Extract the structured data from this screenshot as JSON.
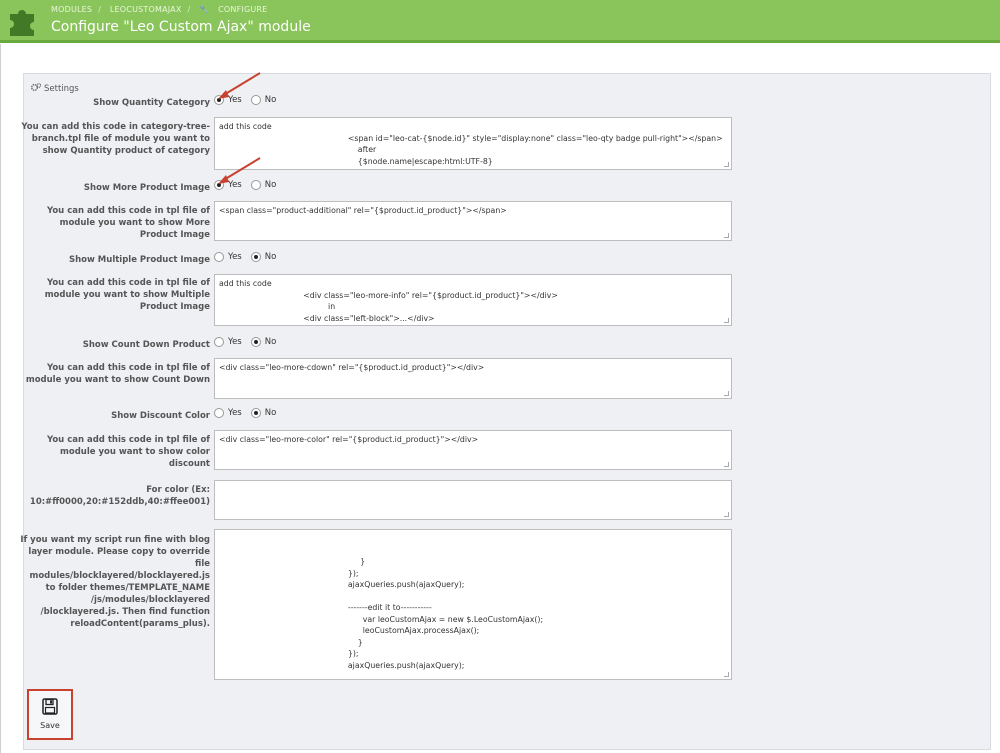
{
  "header": {
    "breadcrumbs": [
      "MODULES",
      "LEOCUSTOMAJAX",
      "CONFIGURE"
    ],
    "title": "Configure \"Leo Custom Ajax\" module"
  },
  "panel": {
    "heading": "Settings"
  },
  "fields": {
    "show_qty_category": {
      "label": "Show Quantity Category",
      "yes": "Yes",
      "no": "No",
      "value": "yes"
    },
    "qty_code": {
      "label": "You can add this code in category-tree-branch.tpl file of module you want to show Quantity product of category",
      "value": "add this code\n                                                    <span id=\"leo-cat-{$node.id}\" style=\"display:none\" class=\"leo-qty badge pull-right\"></span>\n                                                        after\n                                                        {$node.name|escape:html:UTF-8}"
    },
    "show_more_image": {
      "label": "Show More Product Image",
      "yes": "Yes",
      "no": "No",
      "value": "yes"
    },
    "more_image_code": {
      "label": "You can add this code in tpl file of module you want to show More Product Image",
      "value": "<span class=\"product-additional\" rel=\"{$product.id_product}\"></span>"
    },
    "show_multiple_image": {
      "label": "Show Multiple Product Image",
      "yes": "Yes",
      "no": "No",
      "value": "no"
    },
    "multiple_image_code": {
      "label": "You can add this code in tpl file of module you want to show Multiple Product Image",
      "value": "add this code\n                                  <div class=\"leo-more-info\" rel=\"{$product.id_product}\"></div>\n                                            in\n                                  <div class=\"left-block\">...</div>"
    },
    "show_countdown": {
      "label": "Show Count Down Product",
      "yes": "Yes",
      "no": "No",
      "value": "no"
    },
    "countdown_code": {
      "label": "You can add this code in tpl file of module you want to show Count Down",
      "value": "<div class=\"leo-more-cdown\" rel=\"{$product.id_product}\"></div>"
    },
    "show_discount_color": {
      "label": "Show Discount Color",
      "yes": "Yes",
      "no": "No",
      "value": "no"
    },
    "discount_color_code": {
      "label": "You can add this code in tpl file of module you want to show color discount",
      "value": "<div class=\"leo-more-color\" rel=\"{$product.id_product}\"></div>"
    },
    "for_color": {
      "label": "For color (Ex: 10:#ff0000,20:#152ddb,40:#ffee001)",
      "value": ""
    },
    "blocklayered": {
      "label": "If you want my script run fine with blog layer module. Please copy to override file modules/blocklayered/blocklayered.js to folder themes/TEMPLATE_NAME /js/modules/blocklayered /blocklayered.js. Then find function reloadContent(params_plus).",
      "value": "\n\n                                                         }\n                                                    });\n                                                    ajaxQueries.push(ajaxQuery);\n\n                                                    -------edit it to-----------\n                                                          var leoCustomAjax = new $.LeoCustomAjax();\n                                                          leoCustomAjax.processAjax();\n                                                        }\n                                                    });\n                                                    ajaxQueries.push(ajaxQuery);"
    }
  },
  "actions": {
    "save_label": "Save"
  },
  "colors": {
    "header_bg": "#89c55a",
    "highlight": "#c9412f"
  }
}
